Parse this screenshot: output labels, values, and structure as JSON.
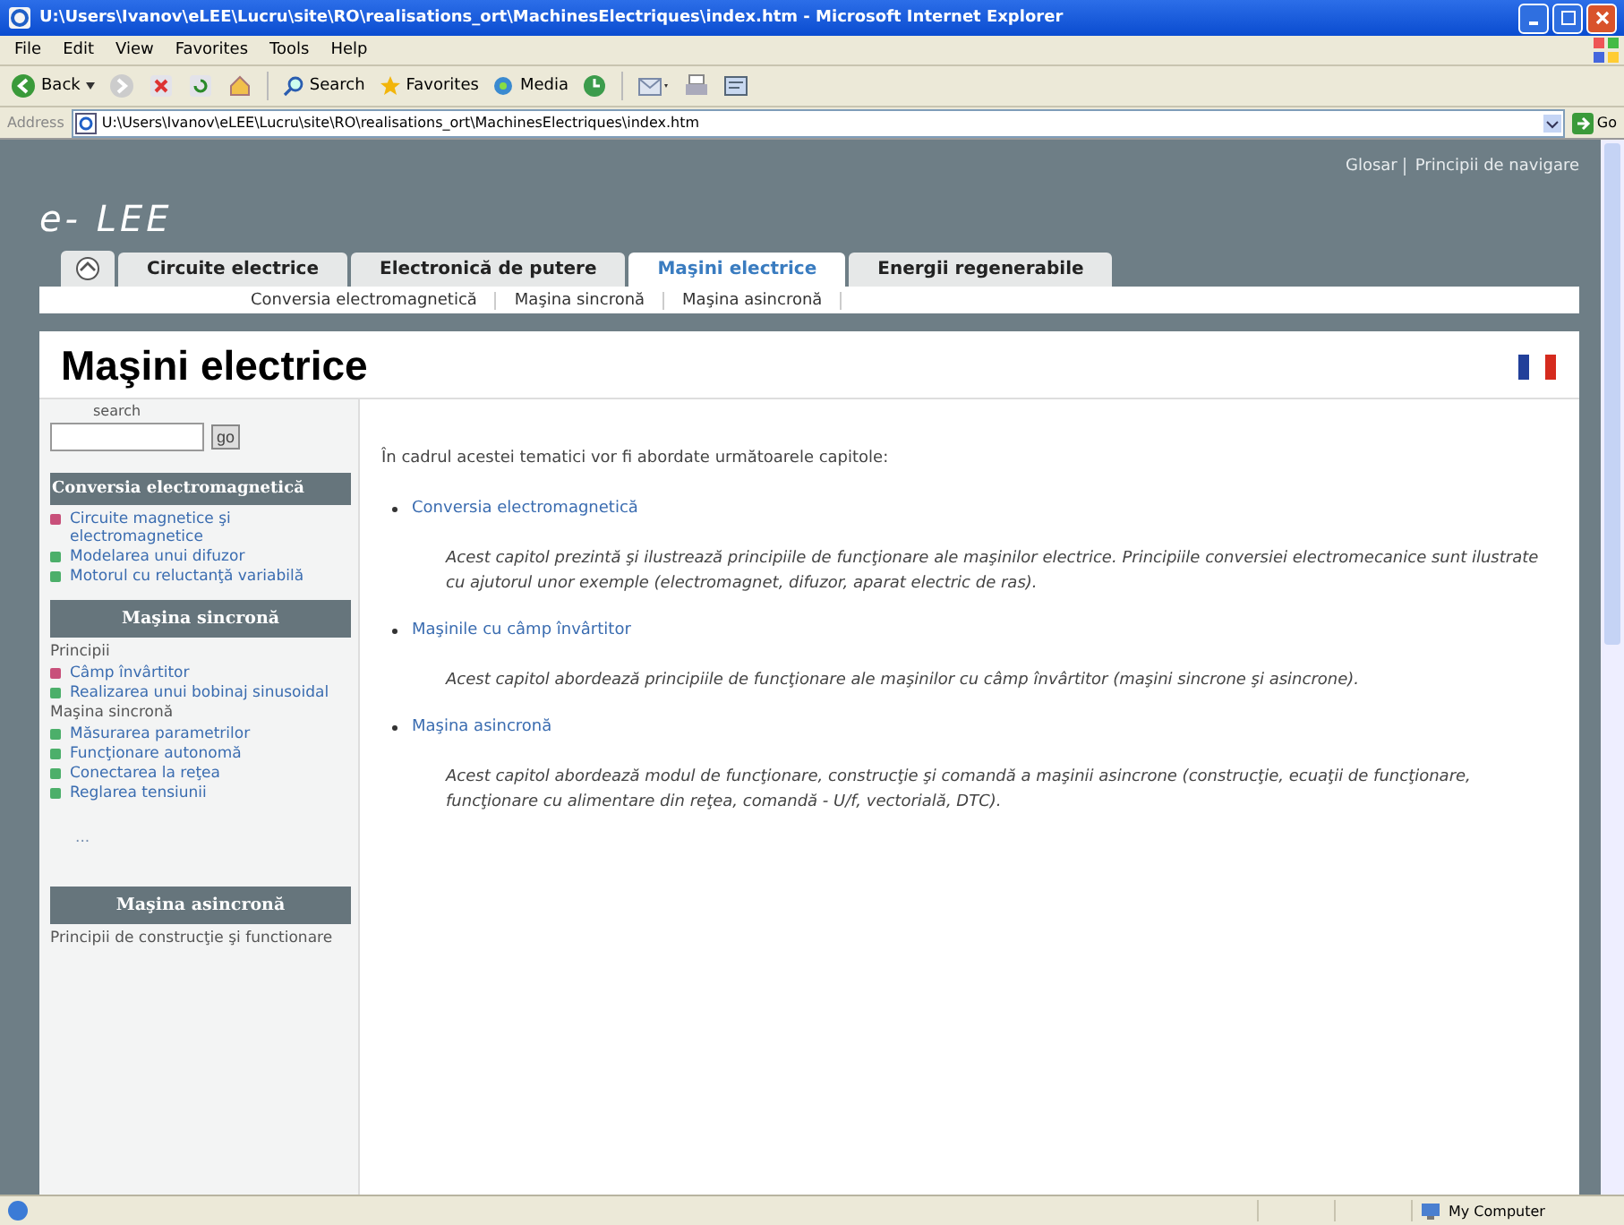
{
  "window": {
    "title": "U:\\Users\\Ivanov\\eLEE\\Lucru\\site\\RO\\realisations_ort\\MachinesElectriques\\index.htm - Microsoft Internet Explorer"
  },
  "menu": [
    "File",
    "Edit",
    "View",
    "Favorites",
    "Tools",
    "Help"
  ],
  "toolbar": {
    "back": "Back",
    "search": "Search",
    "favorites": "Favorites",
    "media": "Media"
  },
  "address": {
    "label": "Address",
    "value": "U:\\Users\\Ivanov\\eLEE\\Lucru\\site\\RO\\realisations_ort\\MachinesElectriques\\index.htm",
    "go": "Go"
  },
  "site": {
    "logo": "e- LEE",
    "top_links": [
      "Glosar",
      "Principii de navigare"
    ]
  },
  "tabs": [
    {
      "label": "Circuite electrice",
      "selected": false
    },
    {
      "label": "Electronică de putere",
      "selected": false
    },
    {
      "label": "Maşini electrice",
      "selected": true
    },
    {
      "label": "Energii regenerabile",
      "selected": false
    }
  ],
  "subnav": [
    "Conversia electromagnetică",
    "Maşina sincronă",
    "Maşina asincronă"
  ],
  "page_title": "Maşini electrice",
  "sidebar": {
    "search_label": "search",
    "search_button": "go",
    "sections": [
      {
        "title": "Conversia electromagnetică",
        "entries": [
          {
            "kind": "link",
            "label": "Circuite magnetice şi electromagnetice",
            "color": "#c8507a"
          },
          {
            "kind": "link",
            "label": "Modelarea unui difuzor",
            "color": "#4caf6a"
          },
          {
            "kind": "link",
            "label": "Motorul cu reluctanţă variabilă",
            "color": "#4caf6a"
          }
        ]
      },
      {
        "title": "Maşina sincronă",
        "entries": [
          {
            "kind": "heading",
            "label": "Principii"
          },
          {
            "kind": "link",
            "label": "Câmp învârtitor",
            "color": "#c8507a"
          },
          {
            "kind": "link",
            "label": "Realizarea unui bobinaj sinusoidal",
            "color": "#4caf6a"
          },
          {
            "kind": "heading",
            "label": "Maşina sincronă"
          },
          {
            "kind": "link",
            "label": "Măsurarea parametrilor",
            "color": "#4caf6a"
          },
          {
            "kind": "link",
            "label": "Funcţionare autonomă",
            "color": "#4caf6a"
          },
          {
            "kind": "link",
            "label": "Conectarea la reţea",
            "color": "#4caf6a"
          },
          {
            "kind": "link",
            "label": "Reglarea tensiunii",
            "color": "#4caf6a"
          },
          {
            "kind": "more",
            "label": "..."
          }
        ]
      },
      {
        "title": "Maşina asincronă",
        "entries": [
          {
            "kind": "heading",
            "label": "Principii de construcţie şi functionare"
          }
        ]
      }
    ]
  },
  "content": {
    "intro": "În cadrul acestei tematici vor fi abordate următoarele capitole:",
    "chapters": [
      {
        "link": "Conversia electromagnetică",
        "description": "Acest capitol prezintă şi ilustrează principiile de funcţionare ale maşinilor electrice. Principiile conversiei electromecanice sunt ilustrate cu ajutorul unor exemple (electromagnet, difuzor, aparat electric de ras)."
      },
      {
        "link": "Maşinile cu câmp învârtitor",
        "description": "Acest capitol abordează principiile de funcţionare ale maşinilor cu câmp învârtitor (maşini sincrone şi asincrone)."
      },
      {
        "link": "Maşina asincronă",
        "description": "Acest capitol abordează modul de funcţionare, construcţie şi comandă a maşinii asincrone (construcţie, ecuaţii de funcţionare, funcţionare cu alimentare din reţea, comandă - U/f, vectorială, DTC)."
      }
    ]
  },
  "status_bar": {
    "zone": "My Computer"
  }
}
